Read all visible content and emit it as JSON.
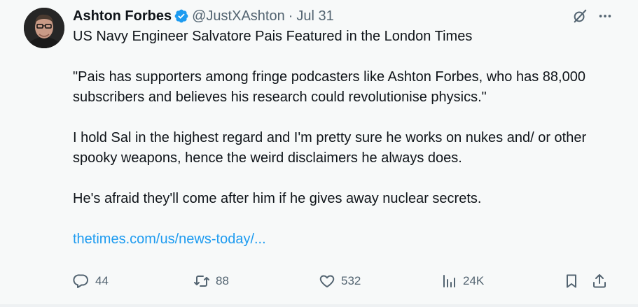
{
  "author": {
    "display_name": "Ashton Forbes",
    "handle": "@JustXAshton",
    "separator": "·",
    "date": "Jul 31",
    "verified": true
  },
  "tweet": {
    "paragraphs": [
      "US Navy Engineer Salvatore Pais Featured in the London Times",
      "\"Pais has supporters among fringe podcasters like Ashton Forbes, who has 88,000 subscribers and believes his research could revolutionise physics.\"",
      "I hold Sal in the highest regard and I'm pretty sure he works on nukes and/ or other spooky weapons, hence the weird disclaimers he always does.",
      "He's afraid they'll come after him if he gives away nuclear secrets."
    ],
    "link_text": "thetimes.com/us/news-today/..."
  },
  "actions": {
    "replies": "44",
    "reposts": "88",
    "likes": "532",
    "views": "24K"
  },
  "icons": {
    "avatar": "avatar-photo",
    "verified": "verified-badge-icon",
    "grok": "grok-icon",
    "more": "more-icon",
    "reply": "reply-icon",
    "repost": "repost-icon",
    "like": "heart-icon",
    "views": "views-chart-icon",
    "bookmark": "bookmark-icon",
    "share": "share-icon"
  },
  "colors": {
    "background": "#f7f9f9",
    "text": "#0f1419",
    "secondary": "#536471",
    "link": "#1d9bf0",
    "verified": "#1d9bf0"
  }
}
